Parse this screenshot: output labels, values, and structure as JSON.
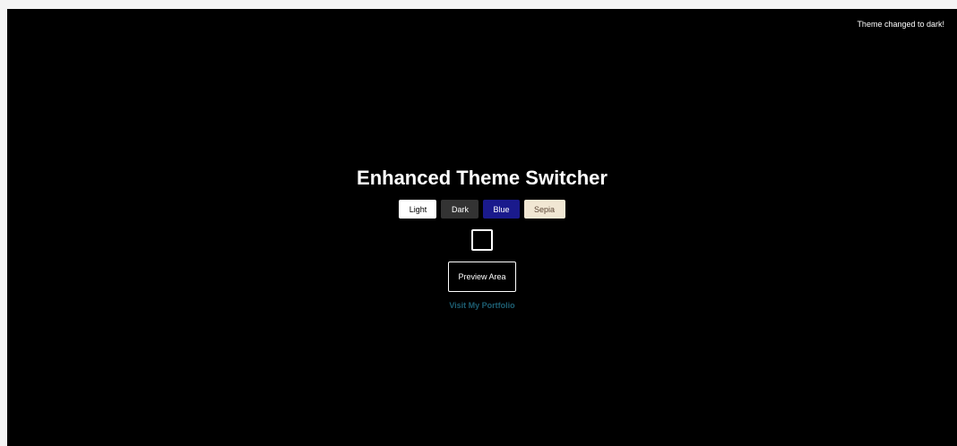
{
  "toast": {
    "message": "Theme changed to dark!"
  },
  "header": {
    "title": "Enhanced Theme Switcher"
  },
  "theme_buttons": [
    {
      "label": "Light",
      "background": "#ffffff",
      "color": "#000000"
    },
    {
      "label": "Dark",
      "background": "#333333",
      "color": "#ffffff"
    },
    {
      "label": "Blue",
      "background": "#1a1a8c",
      "color": "#ffffff"
    },
    {
      "label": "Sepia",
      "background": "#f1e7d3",
      "color": "#5b4636"
    }
  ],
  "preview": {
    "label": "Preview Area"
  },
  "link": {
    "label": "Visit My Portfolio",
    "color": "#1d5f73"
  },
  "colors": {
    "page_background": "#000000",
    "text": "#ffffff"
  }
}
